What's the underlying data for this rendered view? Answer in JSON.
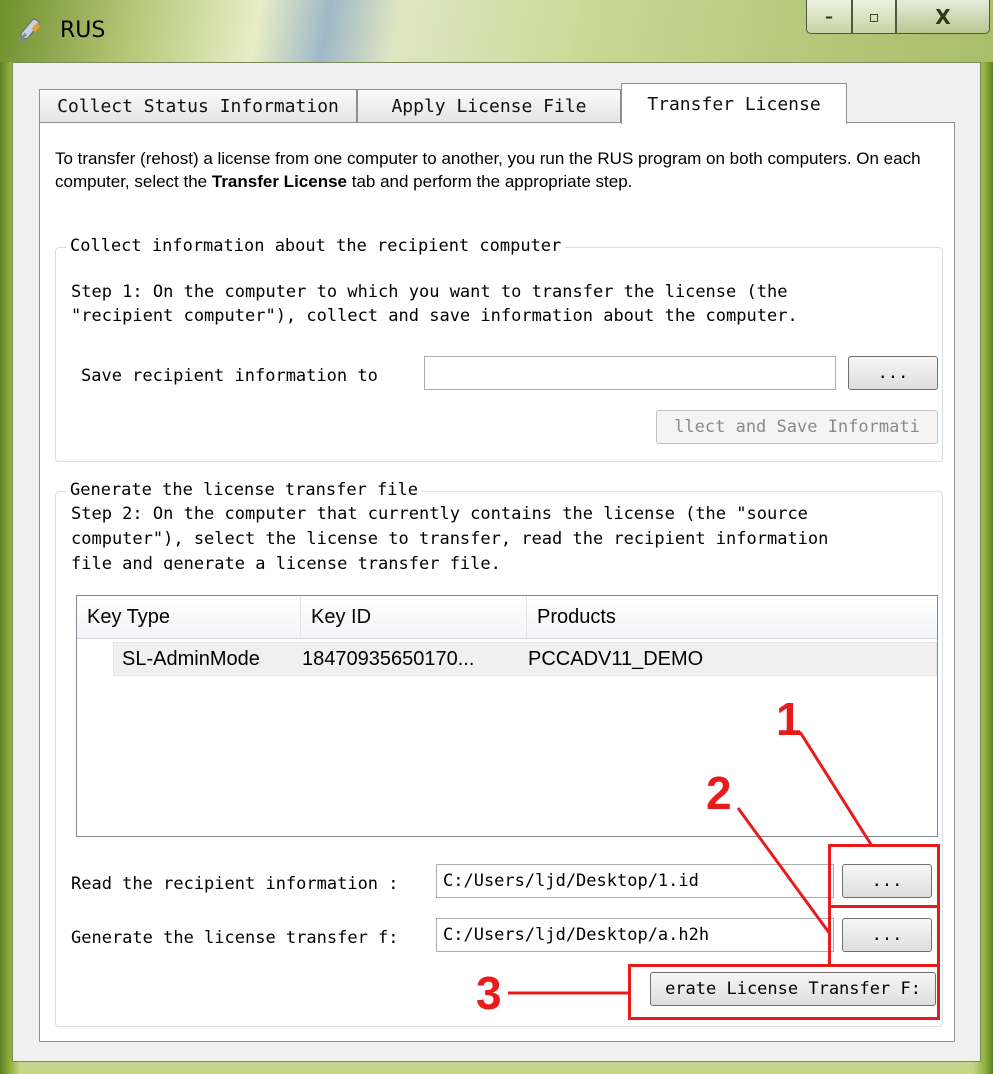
{
  "window": {
    "title": "RUS",
    "icon": "rus-app-icon",
    "controls": {
      "minimize": "–",
      "maximize": "▫",
      "close": "X"
    }
  },
  "tabs": [
    {
      "label": "Collect Status Information",
      "active": false
    },
    {
      "label": "Apply License File",
      "active": false
    },
    {
      "label": "Transfer License",
      "active": true
    }
  ],
  "intro": {
    "before": "To transfer (rehost) a license from one computer to another, you run the RUS program on both computers. On each computer, select the ",
    "bold": "Transfer License",
    "after": " tab and perform the appropriate step."
  },
  "collect_group": {
    "legend": "Collect information about the recipient computer",
    "step_line1": "Step 1: On the computer to which you want to transfer the license (the",
    "step_line2": "\"recipient computer\"), collect and save information about the computer.",
    "save_label": "Save recipient information to",
    "save_value": "",
    "browse_label": "...",
    "collect_button": "llect and Save Informati"
  },
  "generate_group": {
    "legend": "Generate the license transfer file",
    "step_line1": "Step 2: On the computer that currently contains the license (the \"source",
    "step_line2": "computer\"), select the license to transfer, read the recipient information",
    "step_line3": "file and generate a license transfer file.",
    "columns": [
      "Key Type",
      "Key ID",
      "Products"
    ],
    "rows": [
      {
        "key_type": "SL-AdminMode",
        "key_id": "18470935650170...",
        "products": "PCCADV11_DEMO"
      }
    ],
    "read_label": "Read the recipient information :",
    "read_value": "C:/Users/ljd/Desktop/1.id",
    "read_browse": "...",
    "gen_label": "Generate the license transfer f:",
    "gen_value": "C:/Users/ljd/Desktop/a.h2h",
    "gen_browse": "...",
    "generate_button": "erate License Transfer F:"
  },
  "annotations": {
    "n1": "1",
    "n2": "2",
    "n3": "3",
    "color": "#e81b1b"
  }
}
